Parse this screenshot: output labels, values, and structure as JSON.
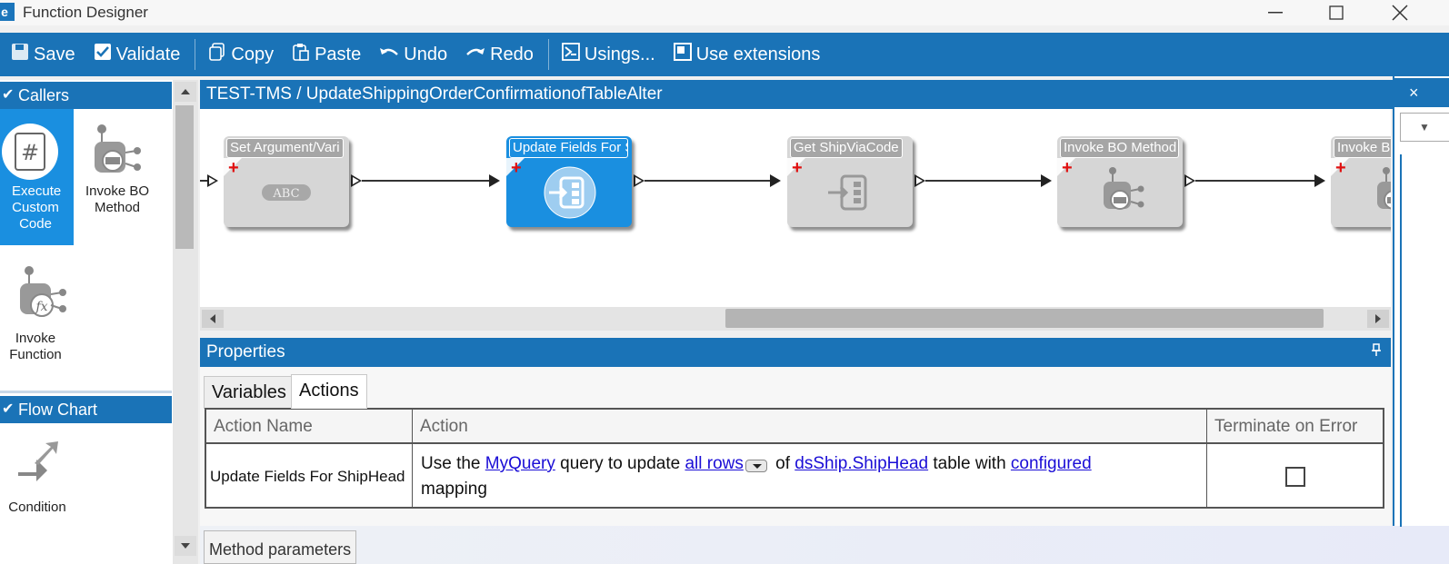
{
  "window": {
    "app_icon_letter": "e",
    "title": "Function Designer",
    "controls": [
      "minimize",
      "maximize",
      "close"
    ]
  },
  "toolbar": {
    "save": "Save",
    "validate": "Validate",
    "copy": "Copy",
    "paste": "Paste",
    "undo": "Undo",
    "redo": "Redo",
    "usings": "Usings...",
    "use_extensions": "Use extensions"
  },
  "palette": {
    "callers": {
      "header": "Callers",
      "items": [
        {
          "label": "Execute Custom Code",
          "icon": "custom-code-icon",
          "selected": true
        },
        {
          "label": "Invoke BO Method",
          "icon": "bo-method-icon",
          "selected": false
        },
        {
          "label": "Invoke Function",
          "icon": "function-icon",
          "selected": false
        }
      ]
    },
    "flow_chart": {
      "header": "Flow Chart",
      "items": [
        {
          "label": "Condition",
          "icon": "condition-icon"
        }
      ]
    }
  },
  "designer": {
    "breadcrumb": "TEST-TMS / UpdateShippingOrderConfirmationofTableAlter",
    "nodes": [
      {
        "title": "Set Argument/Vari",
        "icon": "abc-icon",
        "selected": false
      },
      {
        "title": "Update Fields For S",
        "icon": "update-fields-icon",
        "selected": true
      },
      {
        "title": "Get ShipViaCode",
        "icon": "update-fields-icon",
        "selected": false
      },
      {
        "title": "Invoke BO Method",
        "icon": "bo-method-icon",
        "selected": false
      },
      {
        "title": "Invoke BO",
        "icon": "bo-method-icon",
        "selected": false
      }
    ],
    "abc_text": "ABC"
  },
  "properties": {
    "title": "Properties",
    "pin_icon": "pin-icon",
    "tabs": [
      {
        "label": "Variables",
        "active": false
      },
      {
        "label": "Actions",
        "active": true
      }
    ],
    "columns": [
      "Action Name",
      "Action",
      "Terminate on Error"
    ],
    "rows": [
      {
        "action_name": "Update Fields For ShipHead",
        "action": {
          "t1": "Use the ",
          "query_link": "MyQuery",
          "t2": " query to update ",
          "rows_link": "all rows",
          "t3": " of ",
          "table_link": "dsShip.ShipHead",
          "t4": " table with ",
          "config_link": "configured",
          "t5": "mapping"
        },
        "terminate_on_error": false
      }
    ]
  },
  "bottom": {
    "method_tab": "Method parameters"
  },
  "right_panel": {
    "close_glyph": "×",
    "dropdown_glyph": "▼"
  }
}
